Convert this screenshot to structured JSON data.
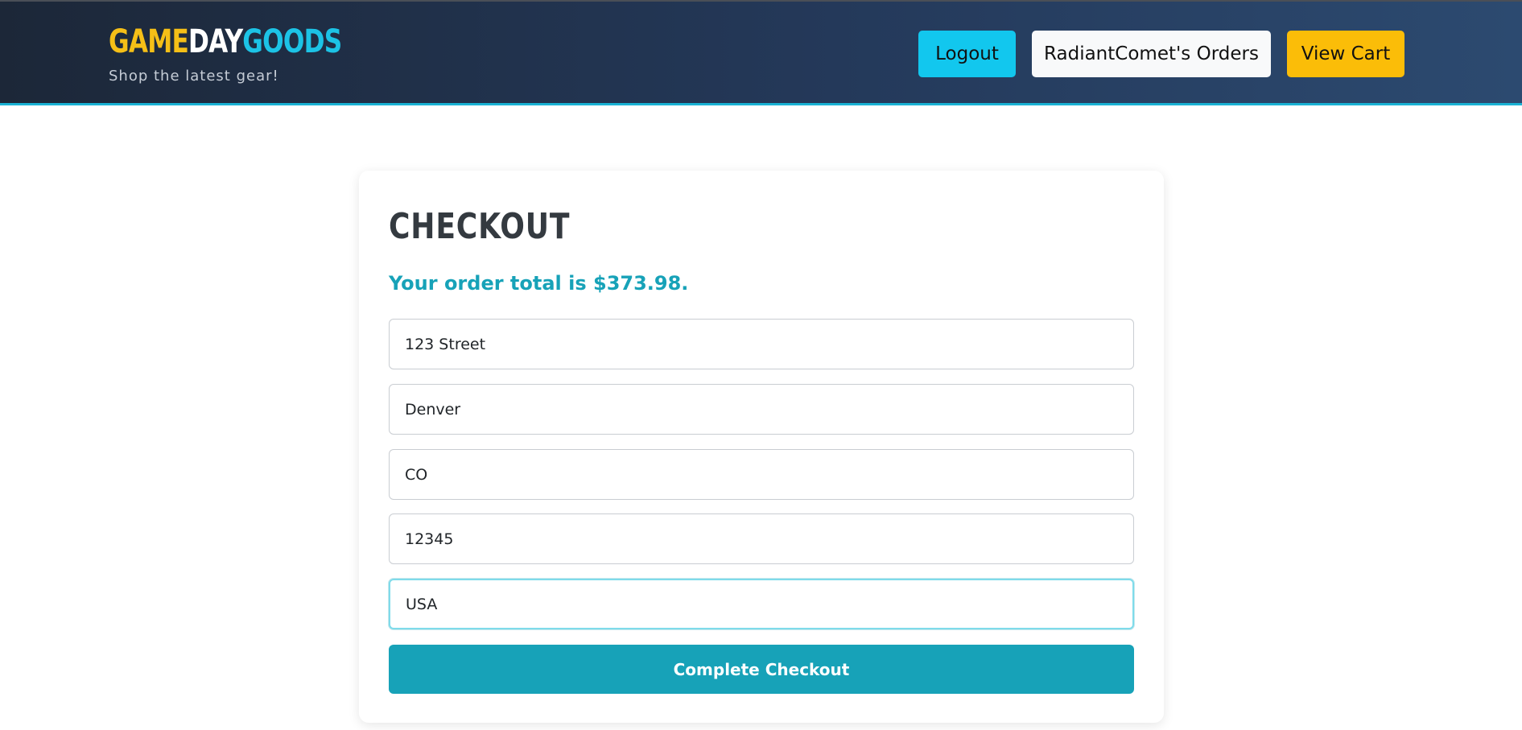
{
  "brand": {
    "part1": "GAME",
    "part2": "DAY",
    "part3": "GOODS",
    "tagline": "Shop the latest gear!",
    "colors": {
      "part1": "#f5bf17",
      "part2": "#ffffff",
      "part3": "#1cc3e6"
    }
  },
  "nav": {
    "logout_label": "Logout",
    "orders_label": "RadiantComet's Orders",
    "cart_label": "View Cart"
  },
  "checkout": {
    "title": "CHECKOUT",
    "total_text": "Your order total is $373.98.",
    "fields": [
      {
        "value": "123 Street"
      },
      {
        "value": "Denver"
      },
      {
        "value": "CO"
      },
      {
        "value": "12345"
      },
      {
        "value": "USA"
      }
    ],
    "submit_label": "Complete Checkout"
  },
  "colors": {
    "accent": "#17a2b8",
    "logout_button": "#12c7ee",
    "cart_button": "#fbbd08"
  }
}
